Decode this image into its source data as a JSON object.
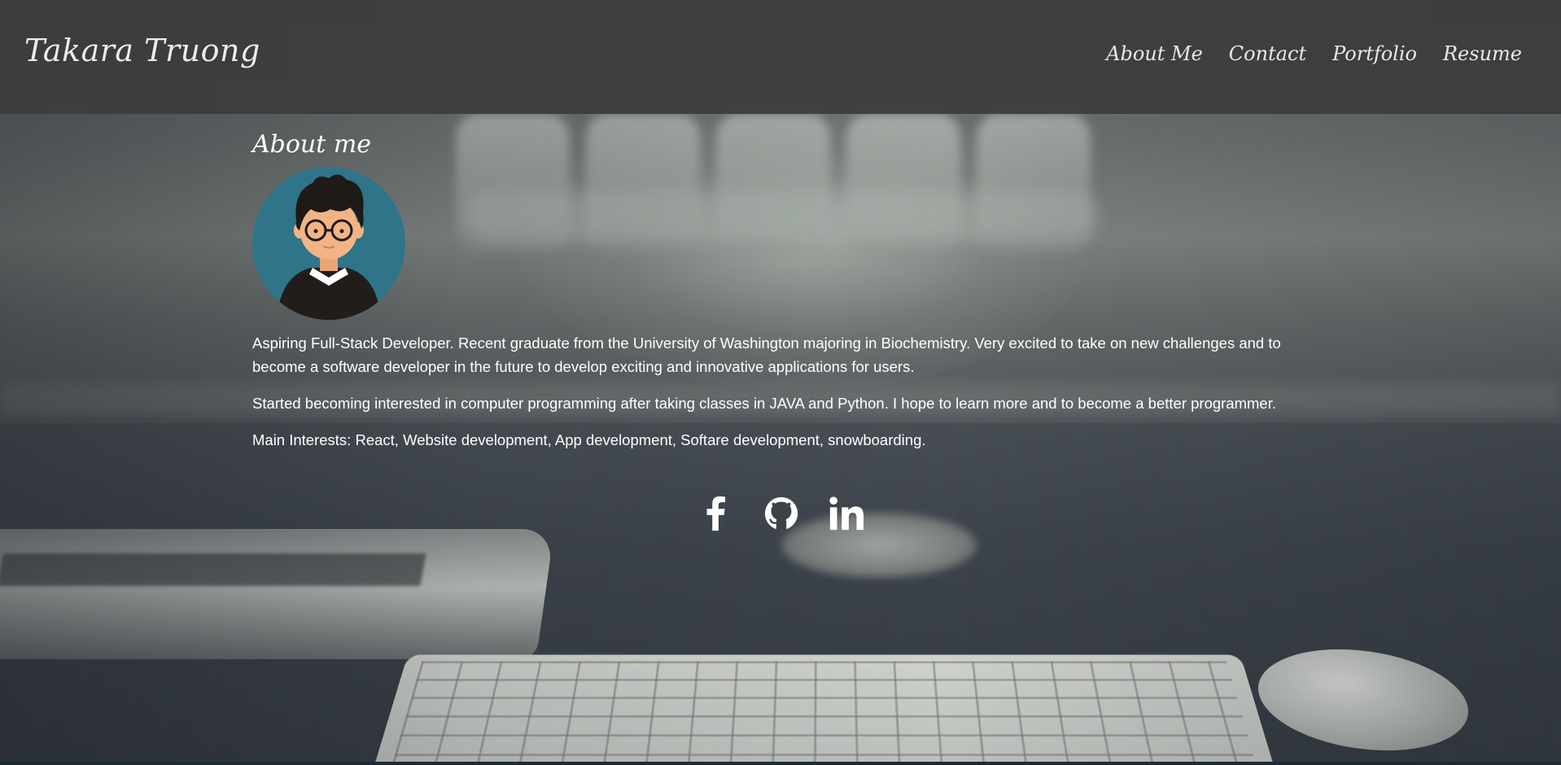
{
  "header": {
    "brand": "Takara Truong",
    "nav": [
      {
        "label": "About Me"
      },
      {
        "label": "Contact"
      },
      {
        "label": "Portfolio"
      },
      {
        "label": "Resume"
      }
    ]
  },
  "about": {
    "title": "About me",
    "avatar_icon": "developer-avatar-icon",
    "paragraphs": [
      "Aspiring Full-Stack Developer. Recent graduate from the University of Washington majoring in Biochemistry. Very excited to take on new challenges and to become a software developer in the future to develop exciting and innovative applications for users.",
      "Started becoming interested in computer programming after taking classes in JAVA and Python. I hope to learn more and to become a better programmer.",
      "Main Interests: React, Website development, App development, Softare development, snowboarding."
    ]
  },
  "social": [
    {
      "icon": "facebook-icon"
    },
    {
      "icon": "github-icon"
    },
    {
      "icon": "linkedin-icon"
    }
  ],
  "colors": {
    "header_bg": "#3c3c3c",
    "text": "#ffffff",
    "avatar_bg": "#2f7489",
    "skin": "#f2b485",
    "hair": "#1e1a17"
  }
}
